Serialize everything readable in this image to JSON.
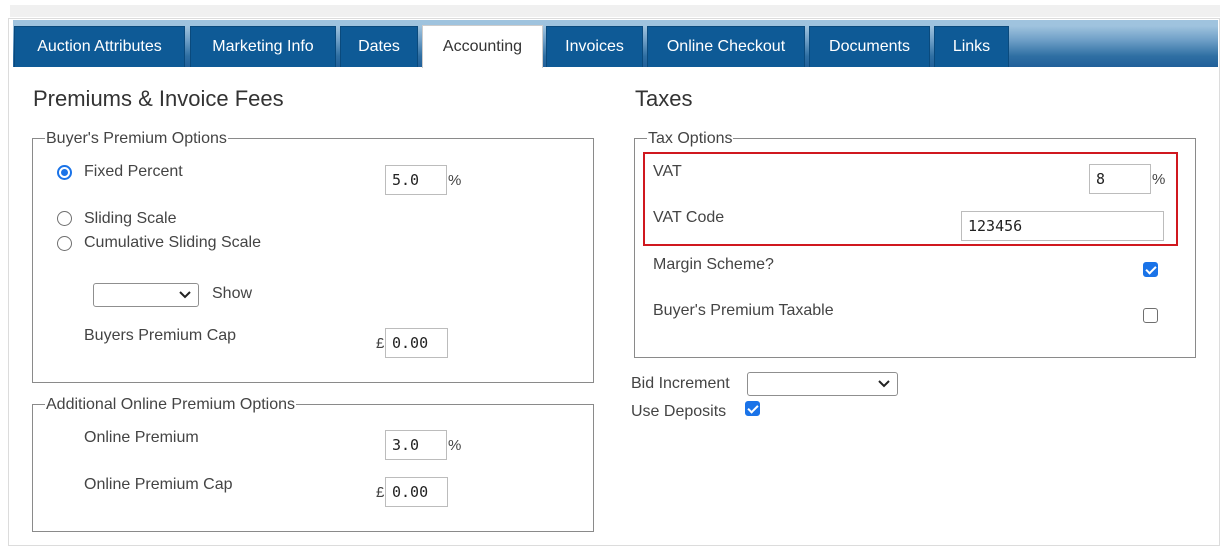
{
  "tabs": [
    {
      "label": "Auction Attributes",
      "active": false
    },
    {
      "label": "Marketing Info",
      "active": false
    },
    {
      "label": "Dates",
      "active": false
    },
    {
      "label": "Accounting",
      "active": true
    },
    {
      "label": "Invoices",
      "active": false
    },
    {
      "label": "Online Checkout",
      "active": false
    },
    {
      "label": "Documents",
      "active": false
    },
    {
      "label": "Links",
      "active": false
    }
  ],
  "left": {
    "title": "Premiums & Invoice Fees",
    "buyers_premium": {
      "legend": "Buyer's Premium Options",
      "fixed_percent_label": "Fixed Percent",
      "fixed_percent_value": "5.0",
      "percent_unit": "%",
      "sliding_scale_label": "Sliding Scale",
      "cumulative_label": "Cumulative Sliding Scale",
      "selected_option": "Fixed Percent",
      "scale_select_value": "",
      "show_label": "Show",
      "cap_label": "Buyers Premium Cap",
      "currency_symbol": "£",
      "cap_value": "0.00"
    },
    "online_premium": {
      "legend": "Additional Online Premium Options",
      "premium_label": "Online Premium",
      "premium_value": "3.0",
      "percent_unit": "%",
      "cap_label": "Online Premium Cap",
      "currency_symbol": "£",
      "cap_value": "0.00"
    }
  },
  "right": {
    "title": "Taxes",
    "tax_options": {
      "legend": "Tax Options",
      "vat_label": "VAT",
      "vat_value": "8",
      "vat_unit": "%",
      "vat_code_label": "VAT Code",
      "vat_code_value": "123456",
      "margin_scheme_label": "Margin Scheme?",
      "margin_scheme_checked": true,
      "bp_taxable_label": "Buyer's Premium Taxable",
      "bp_taxable_checked": false
    },
    "bid_increment_label": "Bid Increment",
    "bid_increment_value": "",
    "use_deposits_label": "Use Deposits",
    "use_deposits_checked": true
  },
  "colors": {
    "tab_blue": "#0e5a96",
    "accent": "#1a73e8",
    "highlight": "#d0181f"
  }
}
